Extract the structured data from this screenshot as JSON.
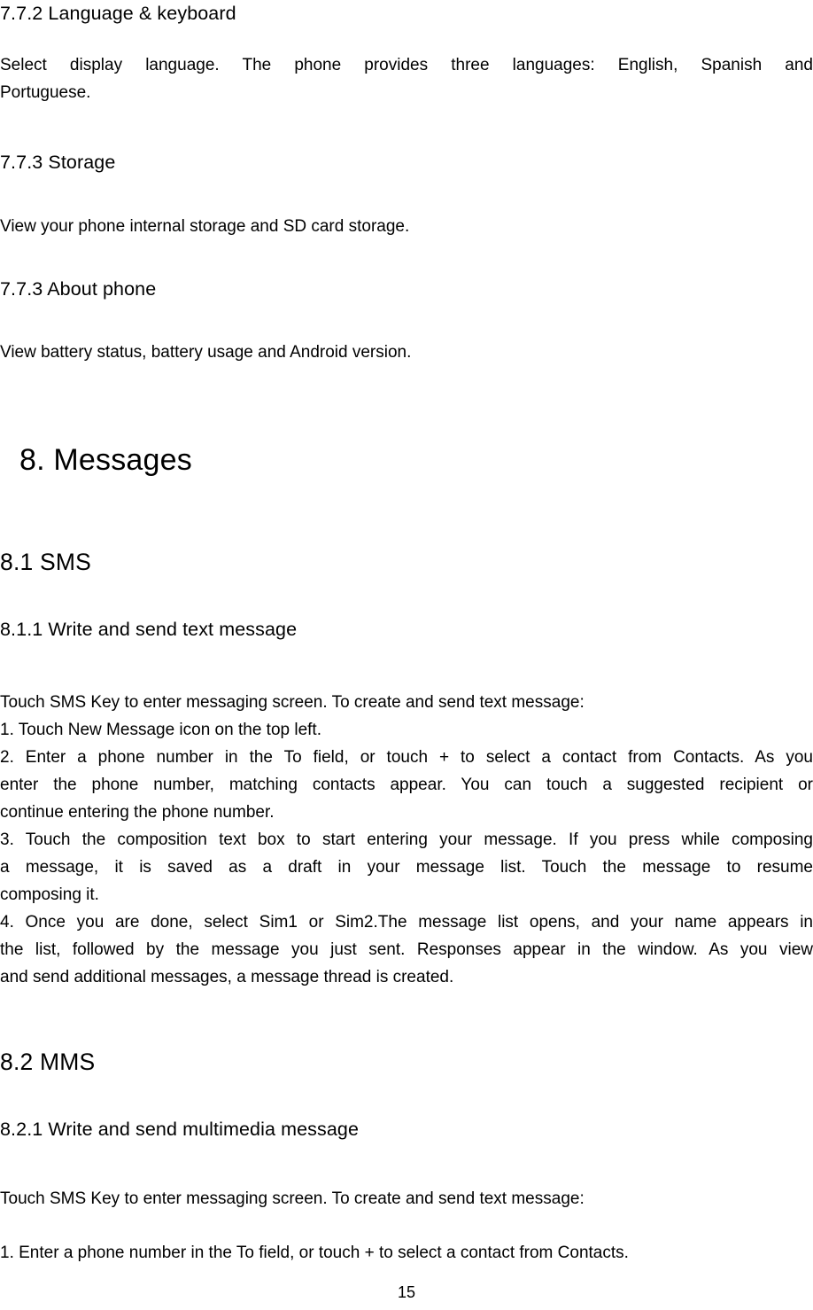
{
  "document": {
    "page_number": "15"
  },
  "sections": [
    {
      "heading": "7.7.2 Language & keyboard",
      "paragraph_lines": [
        "Select display language. The phone provides three languages: English, Spanish and",
        "Portuguese."
      ]
    },
    {
      "heading": "7.7.3 Storage",
      "paragraph_lines": [
        "View your phone internal storage and SD card storage."
      ]
    },
    {
      "heading": "7.7.3 About phone",
      "paragraph_lines": [
        "View battery status, battery usage and Android version."
      ]
    }
  ],
  "chapter": {
    "title": "8. Messages"
  },
  "sms": {
    "heading": "8.1 SMS",
    "subheading": "8.1.1 Write and send text message",
    "intro": "Touch SMS Key to enter messaging screen. To create and send text message:",
    "step1": "1. Touch New Message icon on the top left.",
    "step2_lines": [
      "2. Enter a phone number in the To field, or touch + to select a contact from Contacts. As you",
      "enter the phone number, matching contacts appear. You can touch a suggested recipient or",
      "continue entering the phone number."
    ],
    "step3_lines": [
      "3. Touch the composition text box to start entering your message. If you press while composing",
      "a message, it is saved as a draft in your message list. Touch the message to resume",
      "composing it."
    ],
    "step4_lines": [
      "4. Once you are done, select Sim1 or Sim2.The message list opens, and your name appears in",
      "the list, followed by the message you just sent. Responses appear in the window. As you view",
      "and send additional messages, a message thread is created."
    ]
  },
  "mms": {
    "heading": "8.2 MMS",
    "subheading": "8.2.1 Write and send multimedia message",
    "intro": "Touch SMS Key to enter messaging screen. To create and send text message:",
    "step1": "1. Enter a phone number in the To field, or touch + to select a contact from Contacts."
  }
}
